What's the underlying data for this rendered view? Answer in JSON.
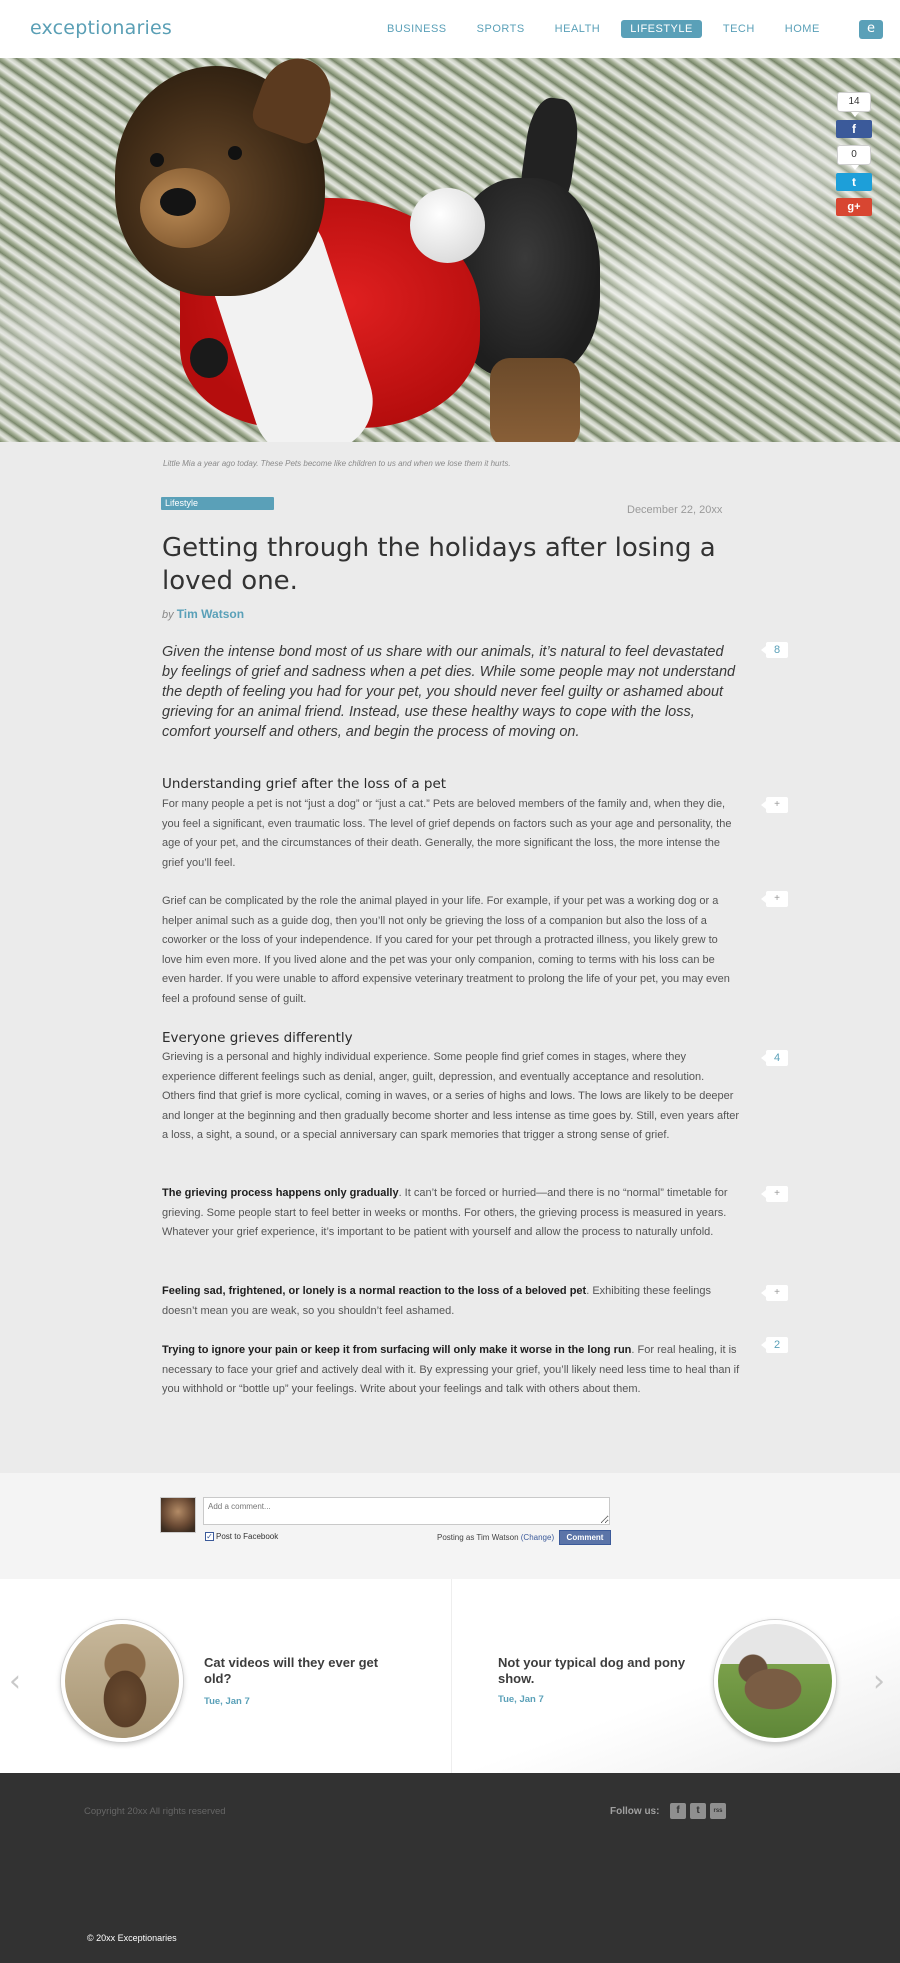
{
  "header": {
    "logo": "exceptionaries",
    "nav": [
      "BUSINESS",
      "SPORTS",
      "HEALTH",
      "LIFESTYLE",
      "TECH",
      "HOME"
    ],
    "active_nav": "LIFESTYLE",
    "menu_icon": "e"
  },
  "share": {
    "facebook_count": "14",
    "facebook_icon": "f",
    "twitter_count": "0",
    "twitter_icon": "t",
    "googleplus_icon": "g+"
  },
  "article": {
    "caption": "Little Mia a year ago today. These Pets become like children to us and when we lose them it hurts.",
    "category": "Lifestyle",
    "date": "December 22, 20xx",
    "title": "Getting through the holidays after losing a loved one.",
    "by": "by",
    "author": "Tim Watson",
    "lead": "Given the intense bond most of us share with our animals, it’s natural to feel devastated by feelings of grief and sadness when a pet dies. While some people may not understand the depth of feeling you had for your pet, you should never feel guilty or ashamed about grieving for an animal friend. Instead, use these healthy ways to cope with the loss, comfort yourself and others, and begin the process of moving on.",
    "h2_1": "Understanding grief after the loss of a pet",
    "p1": "For many people a pet is not “just a dog” or “just a cat.” Pets are beloved members of the family and, when they die, you feel a significant, even traumatic loss. The level of grief depends on factors such as your age and personality, the age of your pet, and the circumstances of their death. Generally, the more significant the loss, the more intense the grief you’ll feel.",
    "p2": "Grief can be complicated by the role the animal played in your life. For example, if your pet was a working dog or a helper animal such as a guide dog, then you’ll not only be grieving the loss of a companion but also the loss of a coworker or the loss of your independence. If you cared for your pet through a protracted illness, you likely grew to love him even more. If you lived alone and the pet was your only companion, coming to terms with his loss can be even harder. If you were unable to afford expensive veterinary treatment to prolong the life of your pet, you may even feel a profound sense of guilt.",
    "h2_2": "Everyone grieves differently",
    "p3": "Grieving is a personal and highly individual experience. Some people find grief comes in stages, where they experience different feelings such as denial, anger, guilt, depression, and eventually acceptance and resolution. Others find that grief is more cyclical, coming in waves, or a series of highs and lows. The lows are likely to be deeper and longer at the beginning and then gradually become shorter and less intense as time goes by. Still, even years after a loss, a sight, a sound, or a special anniversary can spark memories that trigger a strong sense of grief.",
    "p4_bold": "The grieving process happens only gradually",
    "p4": ". It can’t be forced or hurried—and there is no “normal” timetable for grieving. Some people start to feel better in weeks or months. For others, the grieving process is measured in years. Whatever your grief experience, it’s important to be patient with yourself and allow the process to naturally unfold.",
    "p5_bold": "Feeling sad, frightened, or lonely is a normal reaction to the loss of a beloved pet",
    "p5": ". Exhibiting these feelings doesn’t mean you are weak, so you shouldn’t feel ashamed.",
    "p6_bold": "Trying to ignore your pain or keep it from surfacing will only make it worse in the long run",
    "p6": ". For real healing, it is necessary to face your grief and actively deal with it. By expressing your grief, you’ll likely need less time to heal than if you withhold or “bottle up” your feelings. Write about your feelings and talk with others about them."
  },
  "notes": {
    "lead": "8",
    "p1": "+",
    "p2": "+",
    "p3": "4",
    "p4": "+",
    "p5": "+",
    "p6": "2"
  },
  "comments": {
    "placeholder": "Add a comment...",
    "post_to_facebook": "Post to Facebook",
    "checkbox_mark": "✓",
    "posting_as": "Posting as Tim Watson",
    "change": "(Change)",
    "button": "Comment"
  },
  "related": {
    "prev_arrow": "‹",
    "next_arrow": "›",
    "items": [
      {
        "title": "Cat videos will they ever get old?",
        "date": "Tue, Jan 7"
      },
      {
        "title": "Not your typical dog and pony show.",
        "date": "Tue, Jan 7"
      }
    ]
  },
  "footer": {
    "copyright": "Copyright 20xx All rights reserved",
    "follow_us": "Follow us:",
    "social_icons": [
      "f",
      "t",
      "rss"
    ],
    "bottom": "© 20xx Exceptionaries"
  },
  "colors": {
    "accent": "#5aa0b8",
    "facebook": "#3b5a9a",
    "twitter": "#1d9fd9",
    "googleplus": "#d84631",
    "footer_bg": "#323232"
  }
}
